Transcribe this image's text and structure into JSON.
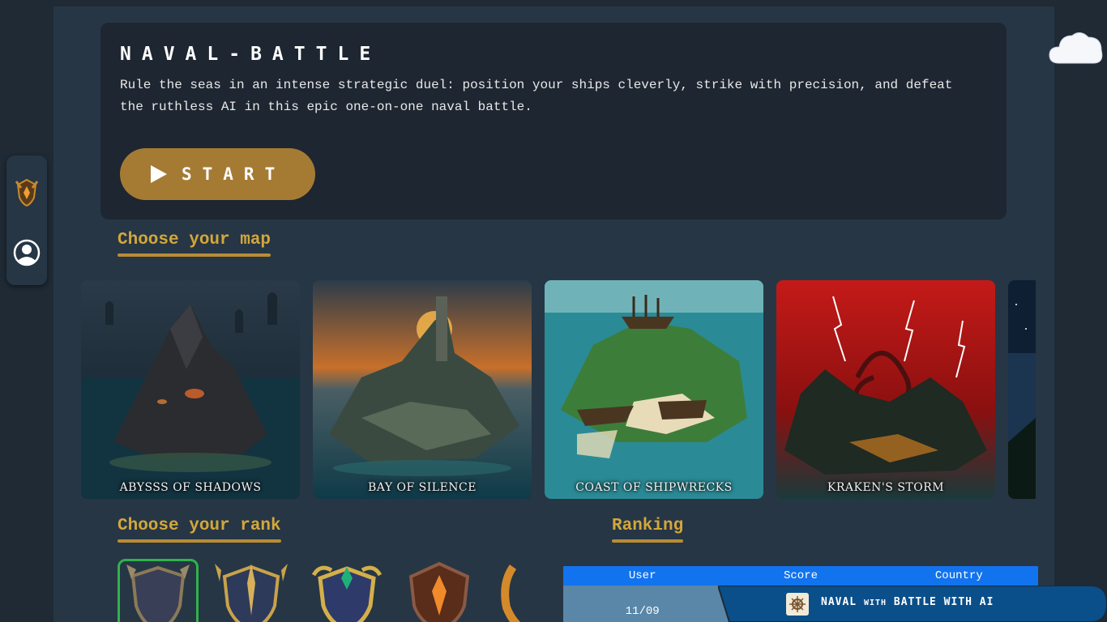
{
  "hero": {
    "title": "NAVAL-BATTLE",
    "description": "Rule the seas in an intense strategic duel: position your ships cleverly, strike with precision, and defeat the ruthless AI in this epic one-on-one naval battle.",
    "start_label": "START"
  },
  "sections": {
    "maps_title": "Choose your map",
    "rank_title": "Choose your rank",
    "ranking_title": "Ranking"
  },
  "maps": [
    {
      "label": "ABYSSS OF SHADOWS"
    },
    {
      "label": "BAY OF SILENCE"
    },
    {
      "label": "COAST OF SHIPWRECKS"
    },
    {
      "label": "KRAKEN'S STORM"
    }
  ],
  "ranking": {
    "headers": [
      "User",
      "Score",
      "Country"
    ],
    "rows": [
      [
        "11/09",
        "",
        ""
      ]
    ]
  },
  "banner": {
    "word1": "NAVAL",
    "word2": "WITH",
    "word3": "BATTLE WITH AI"
  },
  "icons": {
    "sidebar_top": "rank-emblem-icon",
    "sidebar_bottom": "user-profile-icon",
    "weather": "cloud-icon",
    "start": "play-icon"
  },
  "colors": {
    "accent_gold": "#d4a73a",
    "button": "#a57b34",
    "table_header": "#1273ee",
    "selected_rank": "#2fb34a"
  }
}
